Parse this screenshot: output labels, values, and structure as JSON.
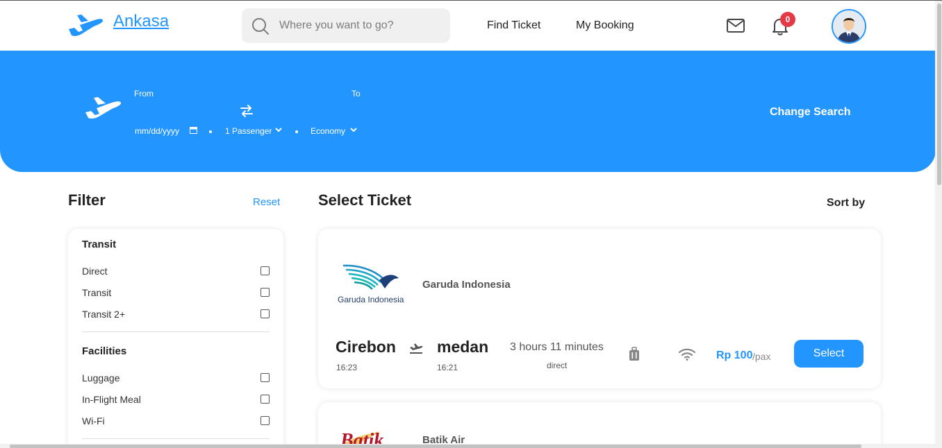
{
  "header": {
    "brand": "Ankasa",
    "search_placeholder": "Where you want to go?",
    "nav": [
      "Find Ticket",
      "My Booking"
    ],
    "notification_count": "0"
  },
  "banner": {
    "from_label": "From",
    "to_label": "To",
    "date_placeholder": "mm/dd/yyyy",
    "passenger": "1 Passenger",
    "class": "Economy",
    "change_search": "Change Search"
  },
  "filter": {
    "title": "Filter",
    "reset": "Reset",
    "sections": [
      {
        "title": "Transit",
        "options": [
          "Direct",
          "Transit",
          "Transit 2+"
        ]
      },
      {
        "title": "Facilities",
        "options": [
          "Luggage",
          "In-Flight Meal",
          "Wi-Fi"
        ]
      }
    ]
  },
  "tickets_section": {
    "title": "Select Ticket",
    "sort_label": "Sort by"
  },
  "tickets": [
    {
      "airline": "Garuda Indonesia",
      "logo_text": "Garuda Indonesia",
      "from_city": "Cirebon",
      "from_time": "16:23",
      "to_city": "medan",
      "to_time": "16:21",
      "duration": "3 hours 11 minutes",
      "route_type": "direct",
      "price": "Rp 100",
      "per": "/pax",
      "button": "Select"
    },
    {
      "airline": "Batik Air",
      "logo_text": "Batik"
    }
  ],
  "colors": {
    "primary": "#2395ff",
    "badge": "#e63946"
  }
}
